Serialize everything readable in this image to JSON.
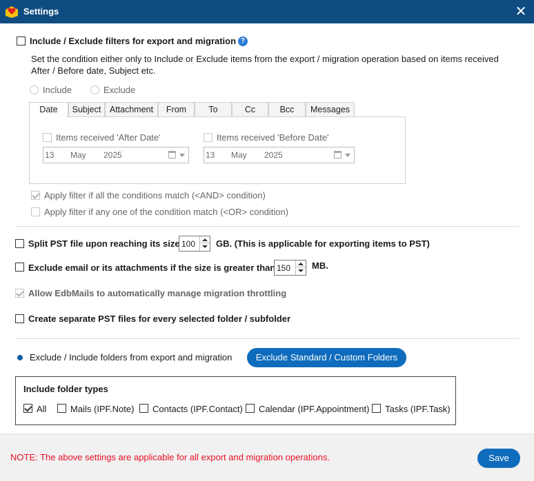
{
  "window": {
    "title": "Settings"
  },
  "filters": {
    "checkbox_label": "Include / Exclude filters for export and migration",
    "description_line1": "Set the condition either only to Include or Exclude items from the export / migration operation based on items received",
    "description_line2": "After / Before date, Subject etc.",
    "include_label": "Include",
    "exclude_label": "Exclude",
    "tabs": [
      "Date",
      "Subject",
      "Attachment",
      "From",
      "To",
      "Cc",
      "Bcc",
      "Messages"
    ],
    "active_tab": "Date",
    "after_date": {
      "label": "Items received 'After Date'",
      "day": "13",
      "month": "May",
      "year": "2025"
    },
    "before_date": {
      "label": "Items received 'Before Date'",
      "day": "13",
      "month": "May",
      "year": "2025"
    },
    "and_condition_label": "Apply filter if all the conditions match (<AND> condition)",
    "or_condition_label": "Apply filter if any one of the condition match (<OR> condition)"
  },
  "options": {
    "split_pst_label": "Split PST file upon reaching its size",
    "split_pst_value": "100",
    "split_pst_suffix": "GB. (This is applicable for exporting items to PST)",
    "exclude_size_label": "Exclude email or its attachments if the size is greater than",
    "exclude_size_value": "150",
    "exclude_size_suffix": "MB.",
    "throttling_label": "Allow EdbMails to automatically manage migration throttling",
    "separate_pst_label": "Create separate PST files for every selected folder / subfolder"
  },
  "folders": {
    "label": "Exclude / Include folders from export and migration",
    "button_label": "Exclude Standard / Custom Folders",
    "group_title": "Include folder types",
    "types": [
      {
        "label": "All",
        "checked": true
      },
      {
        "label": "Mails (IPF.Note)",
        "checked": false
      },
      {
        "label": "Contacts (IPF.Contact)",
        "checked": false
      },
      {
        "label": "Calendar (IPF.Appointment)",
        "checked": false
      },
      {
        "label": "Tasks (IPF.Task)",
        "checked": false
      }
    ]
  },
  "footer": {
    "note": "NOTE: The above settings are applicable for all export and migration operations.",
    "save_label": "Save"
  },
  "colors": {
    "titlebar": "#0f4c81",
    "accent": "#0f6cbd",
    "note": "#e81123"
  }
}
